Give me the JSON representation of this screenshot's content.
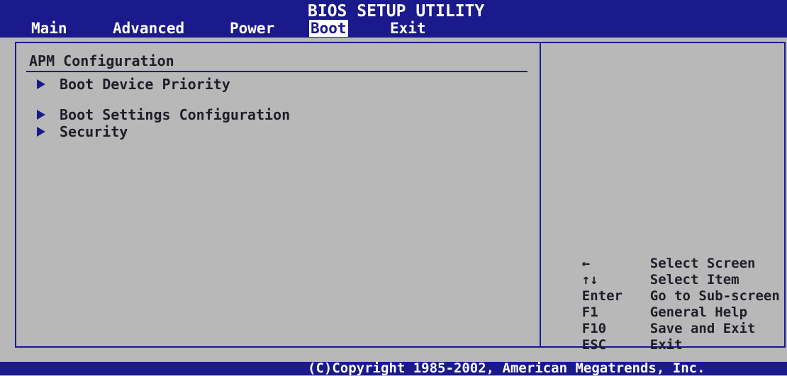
{
  "header": {
    "title": "BIOS SETUP UTILITY",
    "menu": [
      {
        "label": "Main",
        "active": false
      },
      {
        "label": "Advanced",
        "active": false
      },
      {
        "label": "Power",
        "active": false
      },
      {
        "label": "Boot",
        "active": true
      },
      {
        "label": "Exit",
        "active": false
      }
    ]
  },
  "main": {
    "section_title": "APM Configuration",
    "items": [
      {
        "label": "Boot Device Priority"
      },
      {
        "label": "Boot Settings Configuration"
      },
      {
        "label": "Security"
      }
    ]
  },
  "help": [
    {
      "key": "←",
      "desc": "Select Screen"
    },
    {
      "key": "↑↓",
      "desc": "Select Item"
    },
    {
      "key": "Enter",
      "desc": "Go to Sub-screen"
    },
    {
      "key": "F1",
      "desc": "General Help"
    },
    {
      "key": "F10",
      "desc": "Save and Exit"
    },
    {
      "key": "ESC",
      "desc": "Exit"
    }
  ],
  "footer": {
    "copyright": "(C)Copyright 1985-2002, American Megatrends, Inc."
  },
  "colors": {
    "bar_blue": "#1a1a8c",
    "panel_gray": "#b8b8b8",
    "text_dark": "#1f1f2a",
    "text_white": "#ffffff"
  }
}
